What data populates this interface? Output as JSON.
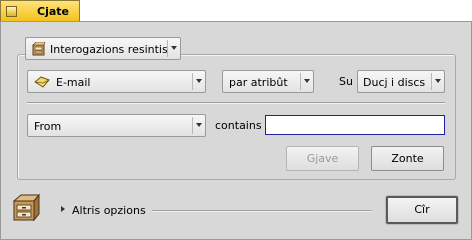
{
  "window": {
    "title": "Cjate"
  },
  "query_mode": {
    "label": "Interogazions resintis"
  },
  "search": {
    "type_label": "E-mail",
    "method_label": "par atribût",
    "in_label": "Su",
    "volume_label": "Ducj i discs"
  },
  "attribute": {
    "field_label": "From",
    "operator_label": "contains",
    "value": ""
  },
  "buttons": {
    "remove_label": "Gjave",
    "add_label": "Zonte",
    "find_label": "Cîr"
  },
  "more_options": {
    "label": "Altris opzions"
  },
  "colors": {
    "tab": "#f3c31b",
    "body": "#d8d8d8",
    "input_focus": "#1f1fa0"
  }
}
